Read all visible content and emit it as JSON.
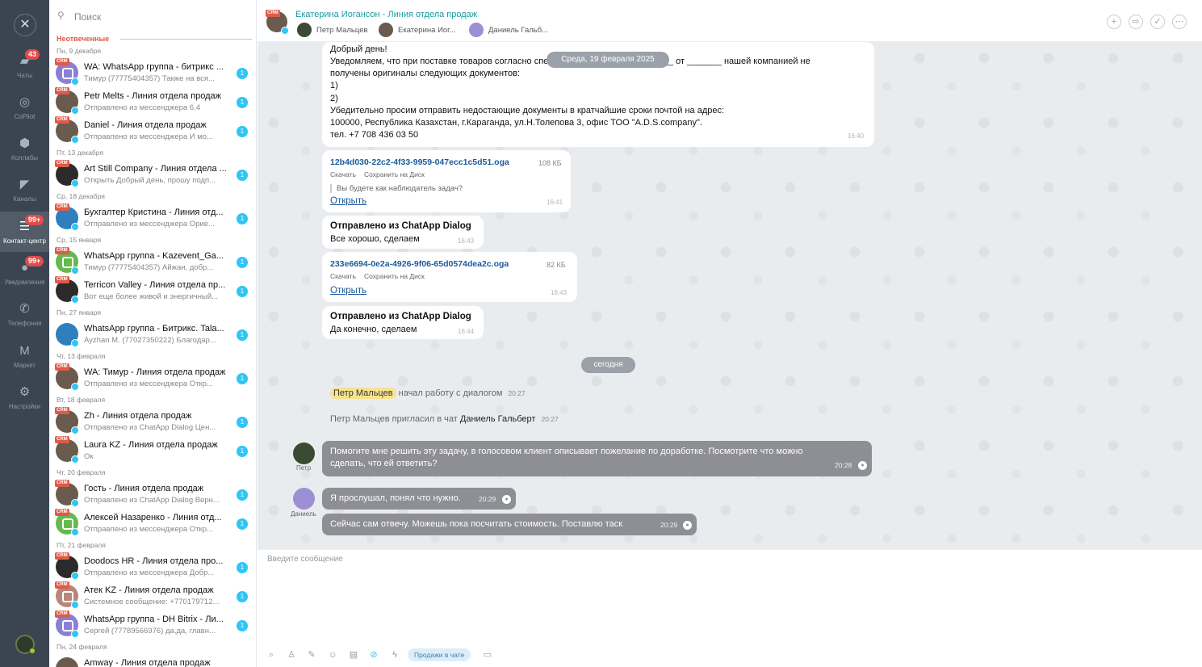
{
  "rail": {
    "close_glyph": "✕",
    "items": [
      {
        "label": "Чаты",
        "icon": "chat-icon",
        "glyph": "▰",
        "count": "43"
      },
      {
        "label": "CoPilot",
        "icon": "copilot-icon",
        "glyph": "◎",
        "count": ""
      },
      {
        "label": "Коллабы",
        "icon": "collab-icon",
        "glyph": "⬢",
        "count": ""
      },
      {
        "label": "Каналы",
        "icon": "megaphone-icon",
        "glyph": "◤",
        "count": ""
      },
      {
        "label": "Контакт-центр",
        "icon": "contact-center-icon",
        "glyph": "☰",
        "count": "99+"
      },
      {
        "label": "Уведомления",
        "icon": "bell-icon",
        "glyph": "●",
        "count": "99+"
      },
      {
        "label": "Телефония",
        "icon": "phone-icon",
        "glyph": "✆",
        "count": ""
      },
      {
        "label": "Маркет",
        "icon": "market-icon",
        "glyph": "M",
        "count": ""
      },
      {
        "label": "Настройки",
        "icon": "gear-icon",
        "glyph": "⚙",
        "count": ""
      }
    ]
  },
  "list": {
    "search_placeholder": "Поиск",
    "section_title": "Неотвеченные",
    "crm_label": "CRM",
    "dates": [
      "Пн, 9 декабря",
      "Пт, 13 декабря",
      "Ср, 18 декабря",
      "Ср, 15 января",
      "Пн, 27 января",
      "Чт, 13 февраля",
      "Вт, 18 февраля",
      "Чт, 20 февраля",
      "Пт, 21 февраля",
      "Пн, 24 февраля"
    ],
    "items": [
      {
        "title": "WA: WhatsApp группа - битрикс ...",
        "sub": "Тимур (77775404357) Также на вся...",
        "badge": "1"
      },
      {
        "title": "Petr Melts - Линия отдела продаж",
        "sub": "Отправлено из мессенджера 6.4",
        "badge": "1"
      },
      {
        "title": "Daniel - Линия отдела продаж",
        "sub": "Отправлено из мессенджера И мо...",
        "badge": "1"
      },
      {
        "title": "Art Still Company - Линия отдела ...",
        "sub": "Открыть Добрый день, прошу подп...",
        "badge": "1"
      },
      {
        "title": "Бухгалтер Кристина - Линия отд...",
        "sub": "Отправлено из мессенджера Орие...",
        "badge": "1"
      },
      {
        "title": "WhatsApp группа - Kazevent_Ga...",
        "sub": "Тимур (77775404357) Айжан, добр...",
        "badge": "1"
      },
      {
        "title": "Terricon Valley - Линия отдела пр...",
        "sub": "Вот еще более живой и энергичный...",
        "badge": "1"
      },
      {
        "title": "WhatsApp группа - Битрикс. Tala...",
        "sub": "Ayzhan M. (77027350222) Благодар...",
        "badge": "1"
      },
      {
        "title": "WA: Тимур - Линия отдела продаж",
        "sub": "Отправлено из мессенджера Откр...",
        "badge": "1"
      },
      {
        "title": "Zh - Линия отдела продаж",
        "sub": "Отправлено из ChatApp Dialog Цен...",
        "badge": "1"
      },
      {
        "title": "Laura KZ - Линия отдела продаж",
        "sub": "Ок",
        "badge": "1"
      },
      {
        "title": "Гость - Линия отдела продаж",
        "sub": "Отправлено из ChatApp Dialog Верн...",
        "badge": "1"
      },
      {
        "title": "Алексей Назаренко - Линия отд...",
        "sub": "Отправлено из мессенджера Откр...",
        "badge": "1"
      },
      {
        "title": "Doodocs HR - Линия отдела про...",
        "sub": "Отправлено из мессенджера Добр...",
        "badge": "1"
      },
      {
        "title": "Атек KZ - Линия отдела продаж",
        "sub": "Системное сообщение: +770179712...",
        "badge": "1"
      },
      {
        "title": "WhatsApp группа - DH Bitrix - Ли...",
        "sub": "Сергей (77789566976) да,да, главн...",
        "badge": "1"
      },
      {
        "title": "Amway - Линия отдела продаж",
        "sub": "",
        "badge": ""
      }
    ]
  },
  "header": {
    "crm_label": "CRM",
    "title": "Екатерина Иогансон - Линия отдела продаж",
    "participants": [
      "Петр Мальцев",
      "Екатерина Иог...",
      "Даниель Гальб..."
    ],
    "buttons": [
      {
        "icon": "plus-icon",
        "glyph": "+"
      },
      {
        "icon": "forward-icon",
        "glyph": "⇨"
      },
      {
        "icon": "check-circle-icon",
        "glyph": "✓"
      },
      {
        "icon": "more-icon",
        "glyph": "⋯"
      }
    ]
  },
  "messages": {
    "letter_lines": [
      "Добрый день!",
      "Уведомляем, что при поставке товаров согласно спецификации #____, упд #_____ от _______ нашей компанией не",
      "получены оригиналы следующих документов:",
      "1)",
      "2)",
      "Убедительно просим отправить недостающие документы в кратчайшие сроки почтой на адрес:",
      "100000, Республика Казахстан, г.Караганда, ул.Н.Толепова 3, офис ТОО \"A.D.S.company\".",
      "тел. +7 708 436 03 50"
    ],
    "letter_time": "16:40",
    "date_pill_1": "Среда, 19 февраля 2025",
    "file1": {
      "name": "12b4d030-22c2-4f33-9959-047ecc1c5d51.oga",
      "size": "108 КБ",
      "download": "Скачать",
      "save": "Сохранить на Диск",
      "quote": "Вы будете как наблюдатель задач?",
      "open": "Открыть",
      "time": "16:41"
    },
    "sent1": {
      "head": "Отправлено из ChatApp Dialog",
      "body": "Все хорошо, сделаем",
      "time": "16:43"
    },
    "file2": {
      "name": "233e6694-0e2a-4926-9f06-65d0574dea2c.oga",
      "size": "82 КБ",
      "download": "Скачать",
      "save": "Сохранить на Диск",
      "open": "Открыть",
      "time": "16:43"
    },
    "sent2": {
      "head": "Отправлено из ChatApp Dialog",
      "body": "Да конечно, сделаем",
      "time": "16:44"
    },
    "date_pill_2": "сегодня",
    "sys1": {
      "tag": "Петр Мальцев",
      "text": "начал работу с диалогом",
      "time": "20:27"
    },
    "sys2": {
      "text": "Петр Мальцев пригласил в чат",
      "name": "Даниель Гальберт",
      "time": "20:27"
    },
    "petr": {
      "name": "Петр",
      "lines": [
        "Помогите мне решить эту задачу, в голосовом клиент описывает пожелание по доработке. Посмотрите что можно",
        "сделать, что ей ответить?"
      ],
      "time": "20:28"
    },
    "daniel": {
      "name": "Даниель",
      "msg1": "Я прослушал, понял что нужно.",
      "time1": "20:29",
      "msg2": "Сейчас сам отвечу. Можешь пока посчитать стоимость. Поставлю таск",
      "time2": "20:29"
    }
  },
  "composer": {
    "placeholder": "Введите сообщение",
    "chip": "Продажи в чате",
    "tools": [
      {
        "icon": "attach-icon",
        "glyph": "⌕"
      },
      {
        "icon": "user-icon",
        "glyph": "♙"
      },
      {
        "icon": "edit-icon",
        "glyph": "✎"
      },
      {
        "icon": "smile-icon",
        "glyph": "☺"
      },
      {
        "icon": "calendar-icon",
        "glyph": "▤"
      },
      {
        "icon": "hidden-icon",
        "glyph": "⊘"
      },
      {
        "icon": "lightning-icon",
        "glyph": "ϟ"
      },
      {
        "icon": "sms-icon",
        "glyph": "▭"
      }
    ]
  },
  "colors": {
    "accent": "#2fc6f6",
    "crm": "#e05a47",
    "rail": "#3b4451",
    "grey_bubble": "#8e8e95",
    "title": "#1b9ba0"
  }
}
